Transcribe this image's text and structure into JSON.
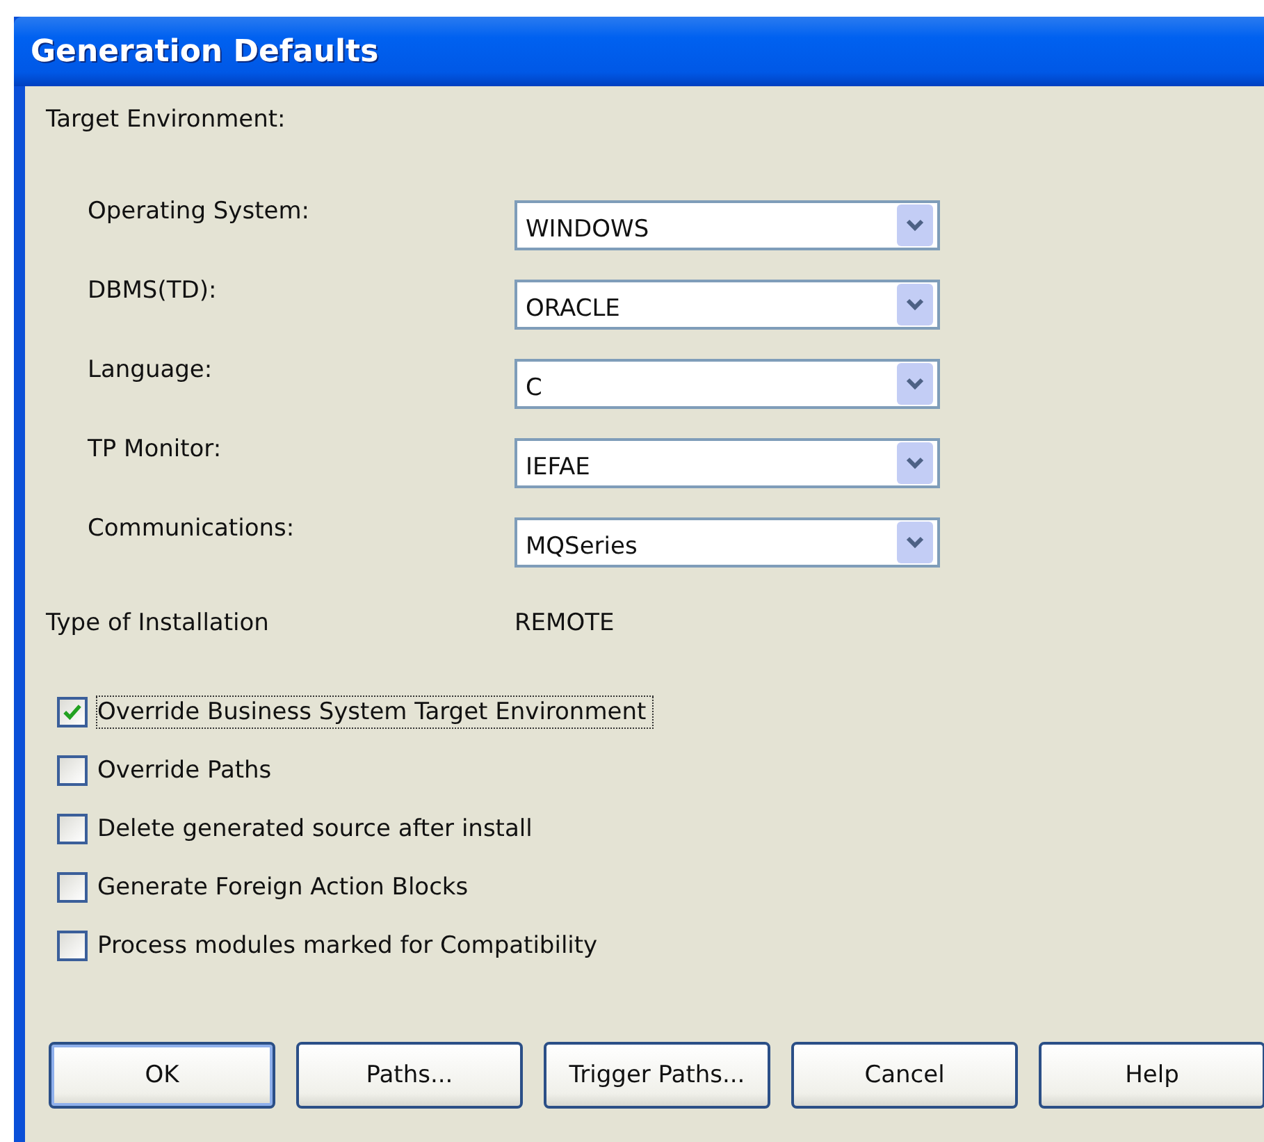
{
  "window": {
    "title": "Generation Defaults"
  },
  "section_label": "Target Environment:",
  "fields": [
    {
      "label": "Operating System:",
      "value": "WINDOWS"
    },
    {
      "label": "DBMS(TD):",
      "value": "ORACLE"
    },
    {
      "label": "Language:",
      "value": "C"
    },
    {
      "label": "TP Monitor:",
      "value": "IEFAE"
    },
    {
      "label": "Communications:",
      "value": "MQSeries"
    }
  ],
  "installation": {
    "label": "Type of Installation",
    "value": "REMOTE"
  },
  "checkboxes": [
    {
      "label": "Override Business System Target Environment",
      "checked": true,
      "focused": true
    },
    {
      "label": "Override Paths",
      "checked": false,
      "focused": false
    },
    {
      "label": "Delete generated source after install",
      "checked": false,
      "focused": false
    },
    {
      "label": "Generate Foreign Action Blocks",
      "checked": false,
      "focused": false
    },
    {
      "label": "Process modules marked for Compatibility",
      "checked": false,
      "focused": false
    }
  ],
  "buttons": [
    {
      "label": "OK",
      "default": true
    },
    {
      "label": "Paths...",
      "default": false
    },
    {
      "label": "Trigger Paths...",
      "default": false
    },
    {
      "label": "Cancel",
      "default": false
    },
    {
      "label": "Help",
      "default": false
    }
  ]
}
